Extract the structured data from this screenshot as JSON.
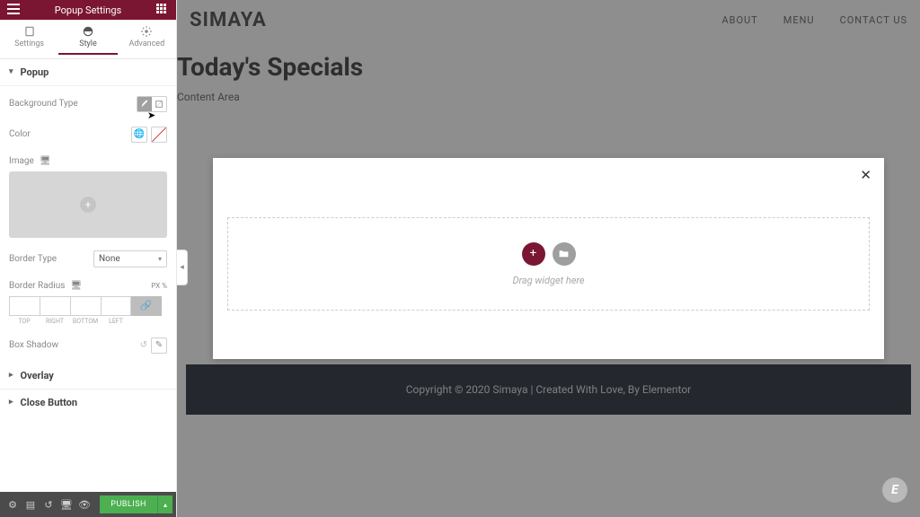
{
  "sidebar": {
    "title": "Popup Settings",
    "tabs": {
      "settings": "Settings",
      "style": "Style",
      "advanced": "Advanced"
    },
    "sections": {
      "popup": "Popup",
      "overlay": "Overlay",
      "close_button": "Close Button"
    },
    "labels": {
      "background_type": "Background Type",
      "color": "Color",
      "image": "Image",
      "border_type": "Border Type",
      "border_radius": "Border Radius",
      "box_shadow": "Box Shadow"
    },
    "border_type_value": "None",
    "border_radius": {
      "top": "",
      "right": "",
      "bottom": "",
      "left": "",
      "unit": "PX  %",
      "side_labels": {
        "top": "TOP",
        "right": "RIGHT",
        "bottom": "BOTTOM",
        "left": "LEFT"
      }
    }
  },
  "footer": {
    "publish": "PUBLISH"
  },
  "site": {
    "logo": "SIMAYA",
    "nav": {
      "about": "ABOUT",
      "menu": "MENU",
      "contact": "CONTACT US"
    },
    "heading": "Today's Specials",
    "content_area": "Content Area",
    "footer_text": "Copyright © 2020 Simaya | Created With Love, By Elementor"
  },
  "popup": {
    "drag_hint": "Drag widget here",
    "close": "✕"
  },
  "icons": {
    "add": "+",
    "folder": "📁",
    "globe": "🌐",
    "pencil": "✎",
    "link": "🔗",
    "reset": "↺",
    "caret_down": "▾",
    "caret_right": "▸",
    "monitor": "🖥",
    "e": "E",
    "collapse": "◂"
  }
}
